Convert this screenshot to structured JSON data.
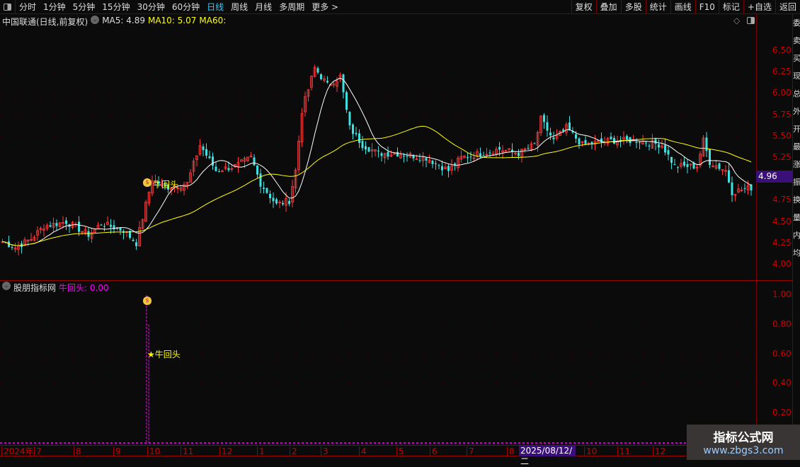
{
  "toolbar": {
    "periods": [
      "分时",
      "1分钟",
      "5分钟",
      "15分钟",
      "30分钟",
      "60分钟",
      "日线",
      "周线",
      "月线",
      "多周期",
      "更多 >"
    ],
    "active": "日线",
    "right": [
      "复权",
      "叠加",
      "多股",
      "统计",
      "画线",
      "F10",
      "标记",
      "+自选",
      "返回"
    ]
  },
  "header": {
    "title": "中国联通(日线,前复权)",
    "ma5": "MA5: 4.89",
    "ma10": "MA10: 5.07",
    "ma60": "MA60:"
  },
  "price_axis": {
    "ticks": [
      "6.50",
      "6.25",
      "6.00",
      "5.75",
      "5.50",
      "5.25",
      "4.75",
      "4.50",
      "4.25",
      "4.00"
    ],
    "current": "4.96"
  },
  "sub": {
    "title": "股朋指标网",
    "indicator": "牛回头: 0.00",
    "ticks": [
      "1.00",
      "0.80",
      "0.60",
      "0.40",
      "0.20"
    ],
    "signal_label": "★牛回头",
    "main_signal_label": "牛回头"
  },
  "xaxis": {
    "labels": [
      "2024年",
      "7",
      "8",
      "9",
      "10",
      "11",
      "12",
      "1",
      "2",
      "3",
      "4",
      "5",
      "6",
      "7",
      "8",
      "10",
      "11",
      "12"
    ],
    "cursor_date": "2025/08/12/二"
  },
  "watermark": {
    "name": "指标公式网",
    "url": "www.zbgs3.com"
  },
  "colors": {
    "up": "#ff3b3b",
    "down": "#3fe0e0",
    "ma5": "#ffffff",
    "ma10": "#ffff00",
    "signal": "#ff00ff"
  },
  "chart_data": {
    "type": "candlestick",
    "close_path": [
      [
        0,
        4.27
      ],
      [
        4,
        4.2
      ],
      [
        9,
        4.3
      ],
      [
        13,
        4.45
      ],
      [
        20,
        4.5
      ],
      [
        27,
        4.35
      ],
      [
        31,
        4.48
      ],
      [
        38,
        4.4
      ],
      [
        42,
        4.25
      ],
      [
        44,
        4.55
      ],
      [
        47,
        5.0
      ],
      [
        51,
        4.9
      ],
      [
        58,
        4.95
      ],
      [
        62,
        5.4
      ],
      [
        67,
        5.1
      ],
      [
        73,
        5.15
      ],
      [
        78,
        5.25
      ],
      [
        81,
        4.95
      ],
      [
        86,
        4.7
      ],
      [
        90,
        4.75
      ],
      [
        92,
        5.1
      ],
      [
        94,
        5.8
      ],
      [
        98,
        6.3
      ],
      [
        102,
        6.1
      ],
      [
        106,
        6.2
      ],
      [
        109,
        5.6
      ],
      [
        113,
        5.4
      ],
      [
        118,
        5.3
      ],
      [
        124,
        5.3
      ],
      [
        133,
        5.25
      ],
      [
        140,
        5.1
      ],
      [
        144,
        5.25
      ],
      [
        156,
        5.35
      ],
      [
        162,
        5.3
      ],
      [
        167,
        5.4
      ],
      [
        169,
        5.7
      ],
      [
        173,
        5.45
      ],
      [
        177,
        5.6
      ],
      [
        182,
        5.4
      ],
      [
        191,
        5.45
      ],
      [
        200,
        5.45
      ],
      [
        207,
        5.4
      ],
      [
        211,
        5.15
      ],
      [
        218,
        5.15
      ],
      [
        220,
        5.45
      ],
      [
        222,
        5.2
      ],
      [
        227,
        5.1
      ],
      [
        229,
        4.85
      ],
      [
        235,
        4.9
      ]
    ],
    "signal_value": 1.0
  }
}
